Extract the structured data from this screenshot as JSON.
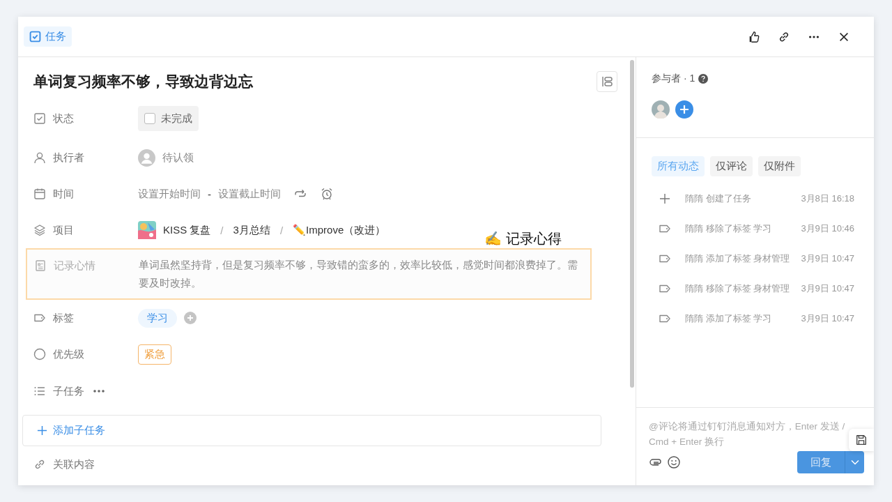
{
  "header": {
    "badge": "任务"
  },
  "title": "单词复习频率不够，导致边背边忘",
  "fields": [
    {
      "kind": "status",
      "label": "状态",
      "value": "未完成",
      "checked": false
    },
    {
      "kind": "assignee",
      "label": "执行者",
      "value": "待认领"
    },
    {
      "kind": "time",
      "label": "时间",
      "start": "设置开始时间",
      "separator": "-",
      "end": "设置截止时间"
    },
    {
      "kind": "project",
      "label": "项目",
      "path": [
        "KISS 复盘",
        "3月总结",
        "✏️Improve（改进）"
      ],
      "separator": "/"
    },
    {
      "kind": "note",
      "label": "记录心情",
      "value": "单词虽然坚持背，但是复习频率不够，导致错的蛮多的，效率比较低，感觉时间都浪费掉了。需要及时改掉。",
      "highlighted": true
    },
    {
      "kind": "tags",
      "label": "标签",
      "tags": [
        "学习"
      ]
    },
    {
      "kind": "priority",
      "label": "优先级",
      "value": "紧急"
    },
    {
      "kind": "subtasks",
      "label": "子任务"
    }
  ],
  "add_subtask": "添加子任务",
  "related": "关联内容",
  "annotation": "✍️ 记录心得",
  "participants": {
    "label": "参与者 · 1"
  },
  "activity_tabs": [
    {
      "label": "所有动态",
      "selected": true
    },
    {
      "label": "仅评论",
      "selected": false
    },
    {
      "label": "仅附件",
      "selected": false
    }
  ],
  "activity": [
    {
      "kind": "create",
      "text": "隋隋 创建了任务",
      "time": "3月8日 16:18"
    },
    {
      "kind": "tag",
      "text": "隋隋 移除了标签 学习",
      "time": "3月9日 10:46"
    },
    {
      "kind": "tag",
      "text": "隋隋 添加了标签 身材管理",
      "time": "3月9日 10:47"
    },
    {
      "kind": "tag",
      "text": "隋隋 移除了标签 身材管理",
      "time": "3月9日 10:47"
    },
    {
      "kind": "tag",
      "text": "隋隋 添加了标签 学习",
      "time": "3月9日 10:47"
    }
  ],
  "comment": {
    "placeholder": "@评论将通过钉钉消息通知对方，Enter 发送 / Cmd + Enter 换行"
  },
  "reply_button": "回复"
}
